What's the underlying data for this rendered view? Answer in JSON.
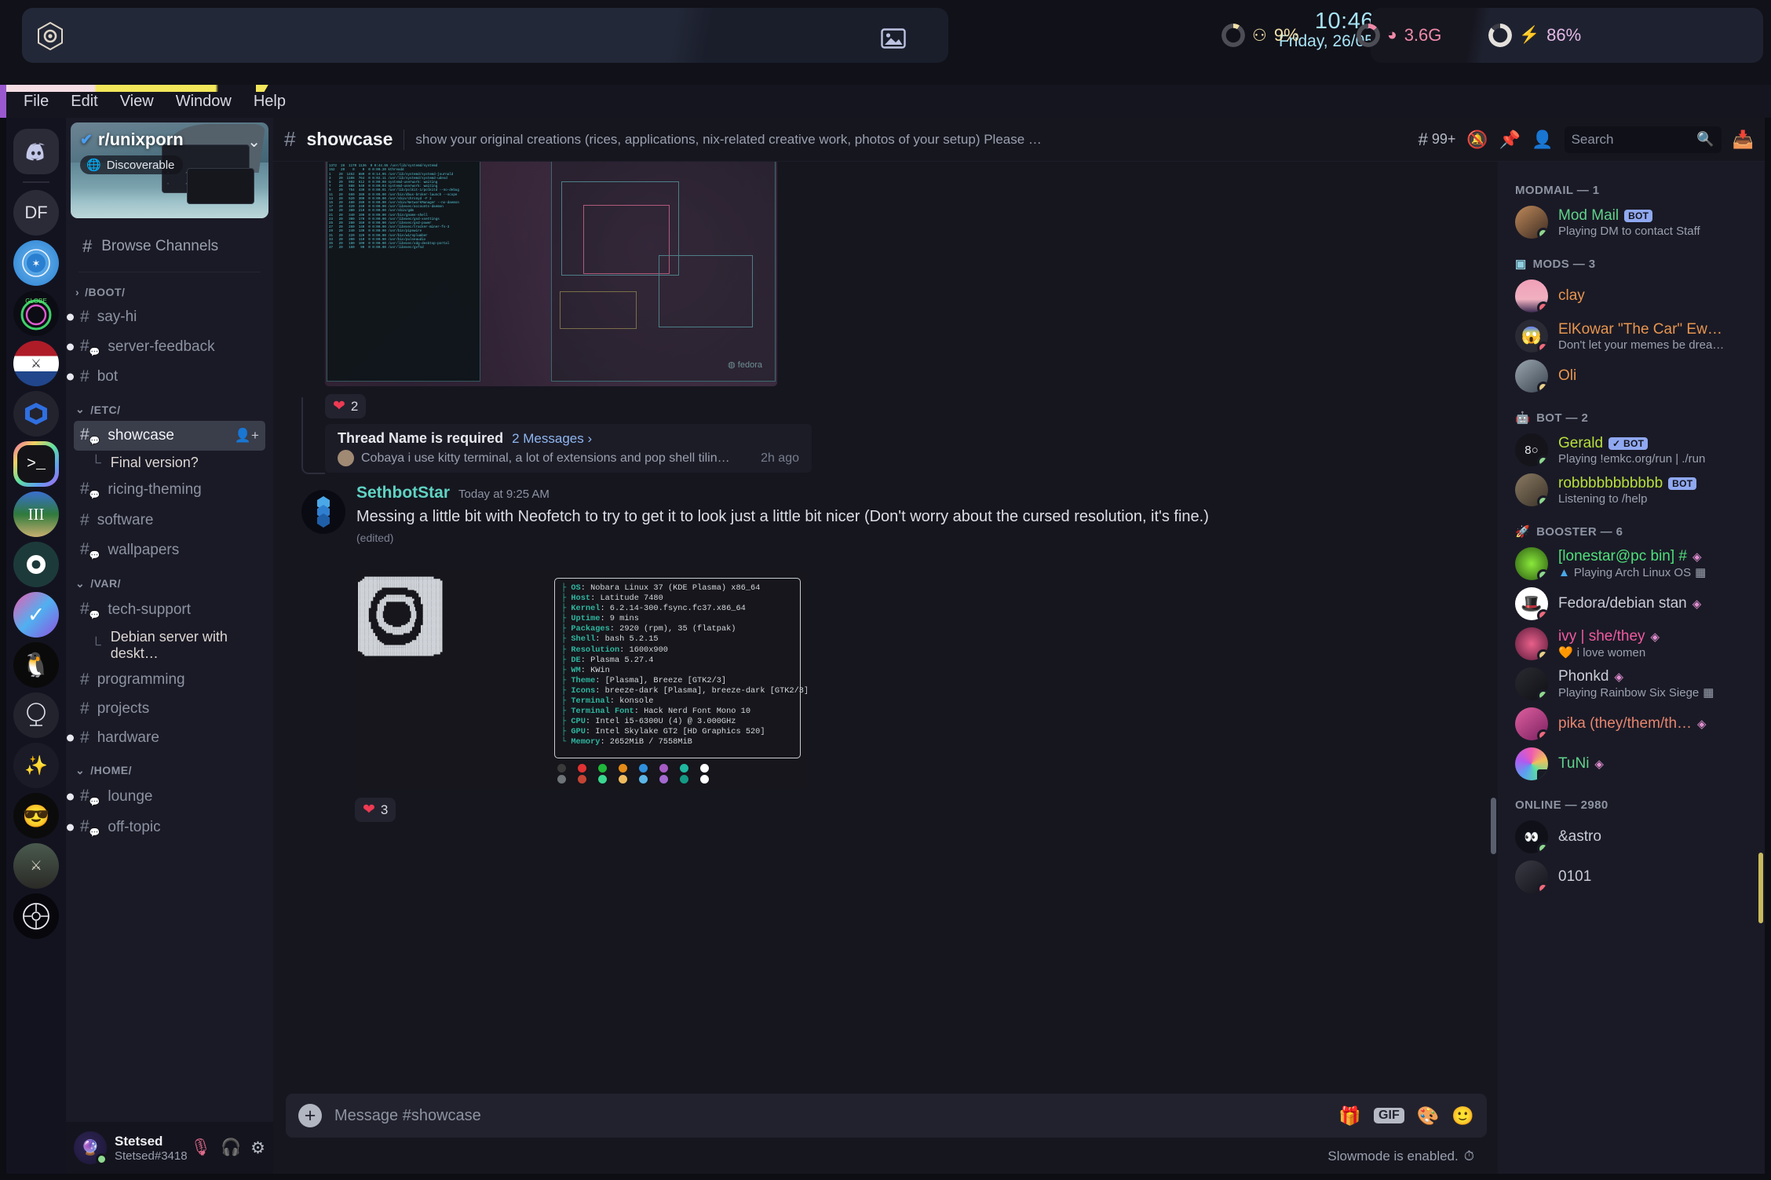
{
  "topbar": {
    "time": "10:46",
    "date": "Friday, 26/05",
    "cpu_label": "9%",
    "ram_label": "3.6G",
    "battery_label": "86%",
    "cpu_icon": "cpu-chip-icon",
    "ram_icon": "memory-icon",
    "battery_icon": "bolt-icon",
    "left_icon": "gear-hex-icon",
    "center_icon": "image-icon",
    "colors": {
      "clock": "#a6e3f5",
      "cpu": "#f2e0a8",
      "ram": "#ef8aa8",
      "battery": "#e6b8e8"
    }
  },
  "menubar": {
    "items": [
      "File",
      "Edit",
      "View",
      "Window",
      "Help"
    ]
  },
  "rail": {
    "servers": [
      {
        "name": "discord-home",
        "label": "",
        "icon": "discord-logo-icon",
        "selected": false
      },
      {
        "name": "DF",
        "label": "DF",
        "icon": "text-icon",
        "selected": false
      },
      {
        "name": "star-federation",
        "label": "",
        "icon": "federation-emblem-icon",
        "selected": false,
        "indicator": "unread"
      },
      {
        "name": "globecraft",
        "label": "",
        "icon": "globecraft-icon",
        "selected": false
      },
      {
        "name": "dutch-flag-server",
        "label": "",
        "icon": "flag-icon",
        "selected": false
      },
      {
        "name": "hexagon-blue-server",
        "label": "",
        "icon": "hexagon-icon",
        "selected": false
      },
      {
        "name": "r-unixporn",
        "label": "",
        "icon": "terminal-prompt-icon",
        "selected": true
      },
      {
        "name": "iii-server",
        "label": "III",
        "icon": "globe-icon",
        "selected": false
      },
      {
        "name": "gear-server",
        "label": "",
        "icon": "gear-icon",
        "selected": false
      },
      {
        "name": "vee-server",
        "label": "",
        "icon": "check-icon",
        "selected": false
      },
      {
        "name": "tux-server",
        "label": "",
        "icon": "penguin-icon",
        "selected": false
      },
      {
        "name": "mirror-server",
        "label": "",
        "icon": "mirror-icon",
        "selected": false
      },
      {
        "name": "feather-server",
        "label": "",
        "icon": "feather-icon",
        "selected": false
      },
      {
        "name": "noiceguy-server",
        "label": "",
        "icon": "sunglasses-emoji-icon",
        "selected": false
      },
      {
        "name": "tarkov-server",
        "label": "",
        "icon": "soldiers-icon",
        "selected": false
      },
      {
        "name": "circuit-server",
        "label": "",
        "icon": "circuit-icon",
        "selected": false
      }
    ]
  },
  "sidebar": {
    "server_name": "r/unixporn",
    "discoverable_label": "Discoverable",
    "browse_channels": "Browse Channels",
    "categories": [
      {
        "label": "/BOOT/",
        "expanded": false,
        "channels": [
          {
            "name": "say-hi",
            "type": "text",
            "unread": true
          },
          {
            "name": "server-feedback",
            "type": "forum",
            "unread": true
          },
          {
            "name": "bot",
            "type": "text",
            "unread": true
          }
        ]
      },
      {
        "label": "/ETC/",
        "expanded": true,
        "channels": [
          {
            "name": "showcase",
            "type": "forum",
            "active": true,
            "unread": false
          },
          {
            "name": "Final version?",
            "type": "thread"
          },
          {
            "name": "ricing-theming",
            "type": "forum",
            "unread": false
          },
          {
            "name": "software",
            "type": "text",
            "unread": false
          },
          {
            "name": "wallpapers",
            "type": "forum",
            "unread": false
          }
        ]
      },
      {
        "label": "/VAR/",
        "expanded": true,
        "channels": [
          {
            "name": "tech-support",
            "type": "forum",
            "unread": false
          },
          {
            "name": "Debian server with deskt…",
            "type": "thread"
          },
          {
            "name": "programming",
            "type": "text",
            "unread": false
          },
          {
            "name": "projects",
            "type": "text",
            "unread": false
          },
          {
            "name": "hardware",
            "type": "text",
            "unread": true
          }
        ]
      },
      {
        "label": "/HOME/",
        "expanded": true,
        "channels": [
          {
            "name": "lounge",
            "type": "forum",
            "unread": true
          },
          {
            "name": "off-topic",
            "type": "forum",
            "unread": true
          }
        ]
      }
    ],
    "user": {
      "name": "Stetsed",
      "tag": "Stetsed#3418",
      "status": "online",
      "icons": [
        "mic-muted-icon",
        "headphones-icon",
        "gear-icon"
      ]
    }
  },
  "channel_header": {
    "hash_icon": "hash-icon",
    "name": "showcase",
    "topic": "show your original creations (rices, applications, nix-related creative work, photos of your setup) Please …",
    "threads_count": "99+",
    "icons": [
      "threads-icon",
      "notification-muted-icon",
      "pin-icon",
      "members-icon",
      "inbox-icon"
    ],
    "search_placeholder": "Search"
  },
  "messages": {
    "reaction1": {
      "emoji": "heart",
      "count": "2"
    },
    "thread": {
      "name": "Thread Name is required",
      "messages_link": "2 Messages ›",
      "preview_author": "Cobaya",
      "preview": "i use kitty terminal, a lot of extensions and pop shell tiling …",
      "ago": "2h ago"
    },
    "post": {
      "author": "SethbotStar",
      "timestamp": "Today at 9:25 AM",
      "body": "Messing a little bit with Neofetch to try to get it to look just a little bit nicer (Don't worry about the cursed resolution, it's fine.)",
      "edited": "(edited)",
      "reaction": {
        "emoji": "heart",
        "count": "3"
      }
    },
    "neofetch": [
      {
        "key": "OS",
        "value": "Nobara Linux 37 (KDE Plasma) x86_64"
      },
      {
        "key": "Host",
        "value": "Latitude 7480"
      },
      {
        "key": "Kernel",
        "value": "6.2.14-300.fsync.fc37.x86_64"
      },
      {
        "key": "Uptime",
        "value": "9 mins"
      },
      {
        "key": "Packages",
        "value": "2920 (rpm), 35 (flatpak)"
      },
      {
        "key": "Shell",
        "value": "bash 5.2.15"
      },
      {
        "key": "Resolution",
        "value": "1600x900"
      },
      {
        "key": "DE",
        "value": "Plasma 5.27.4"
      },
      {
        "key": "WM",
        "value": "KWin"
      },
      {
        "key": "Theme",
        "value": "[Plasma], Breeze [GTK2/3]"
      },
      {
        "key": "Icons",
        "value": "breeze-dark [Plasma], breeze-dark [GTK2/3]"
      },
      {
        "key": "Terminal",
        "value": "konsole"
      },
      {
        "key": "Terminal Font",
        "value": "Hack Nerd Font Mono 10"
      },
      {
        "key": "CPU",
        "value": "Intel i5-6300U (4) @ 3.000GHz"
      },
      {
        "key": "GPU",
        "value": "Intel Skylake GT2 [HD Graphics 520]"
      },
      {
        "key": "Memory",
        "value": "2652MiB / 7558MiB"
      }
    ],
    "swatches_row1": [
      "#3a3a3a",
      "#e03232",
      "#1fb83a",
      "#e58a16",
      "#2f8fdd",
      "#a65cc4",
      "#1fb8a0",
      "#ffffff"
    ],
    "swatches_row2": [
      "#6e7478",
      "#c44434",
      "#3ad88f",
      "#f0bb5e",
      "#5cb6e8",
      "#a36ad0",
      "#159a85",
      "#ffffff"
    ]
  },
  "composer": {
    "placeholder": "Message #showcase",
    "slowmode": "Slowmode is enabled.",
    "icons": [
      "gift-icon",
      "gif-icon",
      "sticker-icon",
      "emoji-icon",
      "plus-icon"
    ],
    "gif_label": "GIF"
  },
  "member_list": {
    "groups": [
      {
        "label": "MODMAIL — 1",
        "icon": null,
        "members": [
          {
            "name": "Mod Mail",
            "color": "#5fd38a",
            "bot": "BOT",
            "sub": "Playing DM to contact Staff",
            "status": "online",
            "avatar": "cat-photo-avatar"
          }
        ]
      },
      {
        "label": "MODS — 3",
        "icon": "terminal-prompt-icon",
        "members": [
          {
            "name": "clay",
            "color": "#e8954e",
            "sub": "",
            "status": "dnd",
            "avatar": "pink-gradient-avatar"
          },
          {
            "name": "ElKowar \"The Car\" Ew…",
            "color": "#e8954e",
            "sub": "Don't let your memes be drea…",
            "status": "dnd",
            "avatar": "scream-meme-avatar"
          },
          {
            "name": "Oli",
            "color": "#e8954e",
            "sub": "",
            "status": "idle",
            "avatar": "bird-photo-avatar"
          }
        ]
      },
      {
        "label": "BOT — 2",
        "icon": "robot-emoji-icon",
        "members": [
          {
            "name": "Gerald",
            "color": "#b7e03a",
            "bot": "✓ BOT",
            "sub": "Playing !emkc.org/run | ./run",
            "status": "online",
            "avatar": "dark-logo-avatar"
          },
          {
            "name": "robbbbbbbbbbb",
            "color": "#b7e03a",
            "bot": "BOT",
            "sub": "Listening to /help",
            "status": "online",
            "avatar": "otter-photo-avatar"
          }
        ]
      },
      {
        "label": "BOOSTER — 6",
        "icon": "rocket-emoji-icon",
        "members": [
          {
            "name": "[lonestar@pc bin] #",
            "color": "#4ee07a",
            "boost": "◈",
            "sub": "Playing Arch Linux OS",
            "sub_icon": "arch-linux-icon",
            "trailing_icon": "activity-icon",
            "status": "online",
            "avatar": "green-anime-avatar"
          },
          {
            "name": "Fedora/debian stan",
            "color": "#c9ccd4",
            "boost": "◈",
            "sub": "",
            "status": "dnd",
            "avatar": "fedora-hat-avatar"
          },
          {
            "name": "ivy | she/they",
            "color": "#f05aa0",
            "boost": "◈",
            "sub": "i love women",
            "sub_icon": "lesbian-heart-icon",
            "status": "idle",
            "avatar": "pink-glow-avatar"
          },
          {
            "name": "Phonkd",
            "color": "#c9ccd4",
            "boost": "◈",
            "sub": "Playing Rainbow Six Siege",
            "trailing_icon": "activity-icon",
            "status": "online",
            "avatar": "dark-car-avatar"
          },
          {
            "name": "pika (they/them/th…",
            "color": "#e8856e",
            "boost": "◈",
            "sub": "",
            "status": "dnd",
            "avatar": "pink-pika-avatar"
          },
          {
            "name": "TuNi",
            "color": "#5fd38a",
            "boost": "◈",
            "sub": "",
            "status": "mobile",
            "avatar": "rainbow-ring-avatar"
          }
        ]
      },
      {
        "label": "ONLINE — 2980",
        "icon": null,
        "members": [
          {
            "name": "&astro",
            "color": "#c9ccd4",
            "sub": "",
            "status": "online",
            "avatar": "dark-eyes-avatar"
          },
          {
            "name": "0101",
            "color": "#c9ccd4",
            "sub": "",
            "status": "dnd",
            "avatar": "dark-photo-avatar"
          }
        ]
      }
    ]
  }
}
